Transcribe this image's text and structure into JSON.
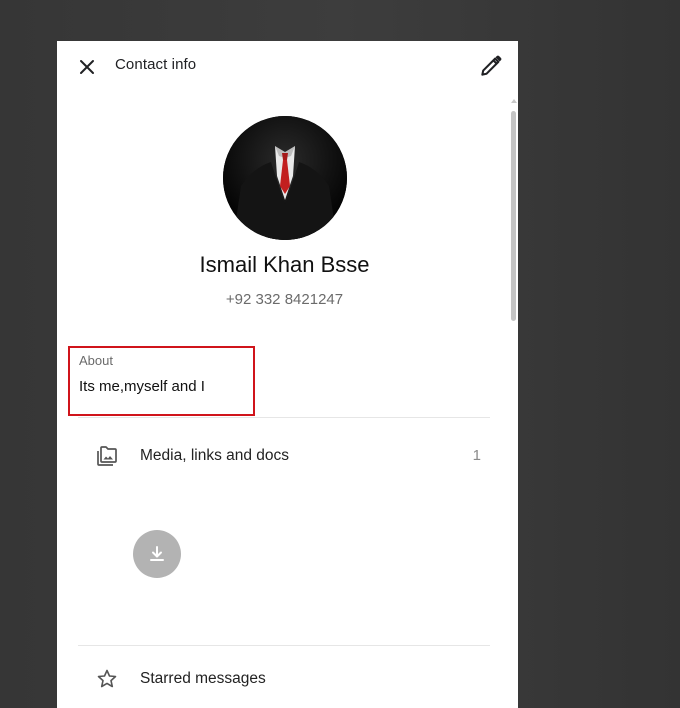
{
  "header": {
    "title": "Contact info",
    "close_icon": "close-icon",
    "edit_icon": "pencil-icon"
  },
  "profile": {
    "name": "Ismail Khan Bsse",
    "phone": "+92 332 8421247"
  },
  "about": {
    "label": "About",
    "text": "Its me,myself and I",
    "highlight_color": "#d0141b"
  },
  "media": {
    "label": "Media, links and docs",
    "count": "1",
    "icon": "media-folder-icon",
    "download_icon": "download-icon"
  },
  "starred": {
    "label": "Starred messages",
    "icon": "star-icon"
  }
}
